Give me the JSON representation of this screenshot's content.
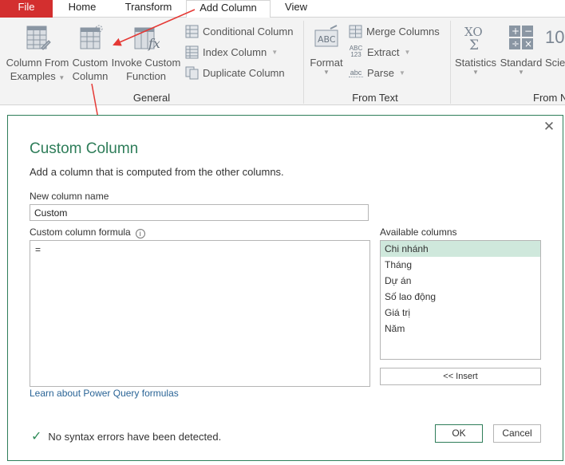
{
  "tabs": {
    "file": "File",
    "home": "Home",
    "transform": "Transform",
    "add_column": "Add Column",
    "view": "View"
  },
  "ribbon": {
    "general": {
      "label": "General",
      "column_from_examples": [
        "Column From",
        "Examples"
      ],
      "custom_column": [
        "Custom",
        "Column"
      ],
      "invoke_custom_function": [
        "Invoke Custom",
        "Function"
      ],
      "conditional_column": "Conditional Column",
      "index_column": "Index Column",
      "duplicate_column": "Duplicate Column"
    },
    "from_text": {
      "label": "From Text",
      "format": "Format",
      "merge_columns": "Merge Columns",
      "extract": "Extract",
      "parse": "Parse",
      "extract_icon_text": [
        "ABC",
        "123"
      ],
      "parse_icon_text": "abc"
    },
    "from_number": {
      "label": "From N",
      "statistics": "Statistics",
      "standard": "Standard",
      "scientific": "Scie",
      "scientific_icon_text": "10"
    }
  },
  "dialog": {
    "title": "Custom Column",
    "subtitle": "Add a column that is computed from the other columns.",
    "name_label": "New column name",
    "name_value": "Custom",
    "formula_label": "Custom column formula",
    "formula_value": "=",
    "learn_link": "Learn about Power Query formulas",
    "available_label": "Available columns",
    "available_columns": [
      "Chi nhánh",
      "Tháng",
      "Dự án",
      "Số lao động",
      "Giá trị",
      "Năm"
    ],
    "insert_label": "<< Insert",
    "status": "No syntax errors have been detected.",
    "ok_label": "OK",
    "cancel_label": "Cancel"
  },
  "colors": {
    "accent": "#2e7d59",
    "file_tab": "#d32f2f",
    "arrow": "#e53935",
    "selected_row": "#cfe8dc"
  }
}
